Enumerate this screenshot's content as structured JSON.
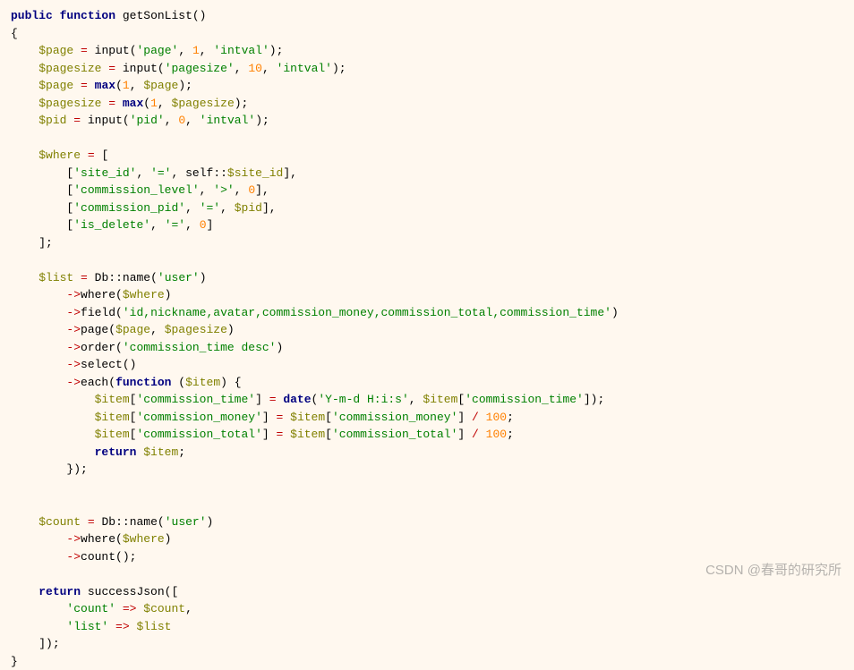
{
  "code": {
    "l1": {
      "kw1": "public",
      "kw2": "function",
      "name": "getSonList",
      "p": "()"
    },
    "l2": {
      "brace": "{"
    },
    "l3": {
      "var": "$page",
      "op": "=",
      "fn": "input",
      "p1": "(",
      "s1": "'page'",
      "c1": ",",
      "n1": "1",
      "c2": ",",
      "s2": "'intval'",
      "p2": ");"
    },
    "l4": {
      "var": "$pagesize",
      "op": "=",
      "fn": "input",
      "p1": "(",
      "s1": "'pagesize'",
      "c1": ",",
      "n1": "10",
      "c2": ",",
      "s2": "'intval'",
      "p2": ");"
    },
    "l5": {
      "var": "$page",
      "op": "=",
      "fn": "max",
      "p1": "(",
      "n1": "1",
      "c1": ",",
      "v2": "$page",
      "p2": ");"
    },
    "l6": {
      "var": "$pagesize",
      "op": "=",
      "fn": "max",
      "p1": "(",
      "n1": "1",
      "c1": ",",
      "v2": "$pagesize",
      "p2": ");"
    },
    "l7": {
      "var": "$pid",
      "op": "=",
      "fn": "input",
      "p1": "(",
      "s1": "'pid'",
      "c1": ",",
      "n1": "0",
      "c2": ",",
      "s2": "'intval'",
      "p2": ");"
    },
    "l9": {
      "var": "$where",
      "op": "=",
      "b": "["
    },
    "l10": {
      "b1": "[",
      "s1": "'site_id'",
      "c1": ",",
      "s2": "'='",
      "c2": ",",
      "scope": "self::",
      "prop": "$site_id",
      "b2": "],",
      "t": ""
    },
    "l11": {
      "b1": "[",
      "s1": "'commission_level'",
      "c1": ",",
      "s2": "'>'",
      "c2": ",",
      "n1": "0",
      "b2": "],",
      "t": ""
    },
    "l12": {
      "b1": "[",
      "s1": "'commission_pid'",
      "c1": ",",
      "s2": "'='",
      "c2": ",",
      "v1": "$pid",
      "b2": "],",
      "t": ""
    },
    "l13": {
      "b1": "[",
      "s1": "'is_delete'",
      "c1": ",",
      "s2": "'='",
      "c2": ",",
      "n1": "0",
      "b2": "]"
    },
    "l14": {
      "b": "];"
    },
    "l16": {
      "var": "$list",
      "op": "=",
      "cls": "Db",
      "sc": "::",
      "fn": "name",
      "p1": "(",
      "s1": "'user'",
      "p2": ")"
    },
    "l17": {
      "arw": "->",
      "fn": "where",
      "p1": "(",
      "v1": "$where",
      "p2": ")"
    },
    "l18": {
      "arw": "->",
      "fn": "field",
      "p1": "(",
      "s1": "'id,nickname,avatar,commission_money,commission_total,commission_time'",
      "p2": ")"
    },
    "l19": {
      "arw": "->",
      "fn": "page",
      "p1": "(",
      "v1": "$page",
      "c1": ",",
      "v2": "$pagesize",
      "p2": ")"
    },
    "l20": {
      "arw": "->",
      "fn": "order",
      "p1": "(",
      "s1": "'commission_time desc'",
      "p2": ")"
    },
    "l21": {
      "arw": "->",
      "fn": "select",
      "p": "()"
    },
    "l22": {
      "arw": "->",
      "fn": "each",
      "p1": "(",
      "kw": "function",
      "p2": "(",
      "v1": "$item",
      "p3": ")",
      "b": "{"
    },
    "l23": {
      "v1": "$item",
      "b1": "[",
      "s1": "'commission_time'",
      "b2": "]",
      "op": "=",
      "fn": "date",
      "p1": "(",
      "s2": "'Y-m-d H:i:s'",
      "c1": ",",
      "v2": "$item",
      "b3": "[",
      "s3": "'commission_time'",
      "b4": "]);",
      "t": ""
    },
    "l24": {
      "v1": "$item",
      "b1": "[",
      "s1": "'commission_money'",
      "b2": "]",
      "op": "=",
      "v2": "$item",
      "b3": "[",
      "s3": "'commission_money'",
      "b4": "]",
      "op2": "/",
      "n1": "100",
      "p": ";"
    },
    "l25": {
      "v1": "$item",
      "b1": "[",
      "s1": "'commission_total'",
      "b2": "]",
      "op": "=",
      "v2": "$item",
      "b3": "[",
      "s3": "'commission_total'",
      "b4": "]",
      "op2": "/",
      "n1": "100",
      "p": ";"
    },
    "l26": {
      "kw": "return",
      "v1": "$item",
      "p": ";"
    },
    "l27": {
      "b": "});"
    },
    "l30": {
      "var": "$count",
      "op": "=",
      "cls": "Db",
      "sc": "::",
      "fn": "name",
      "p1": "(",
      "s1": "'user'",
      "p2": ")"
    },
    "l31": {
      "arw": "->",
      "fn": "where",
      "p1": "(",
      "v1": "$where",
      "p2": ")"
    },
    "l32": {
      "arw": "->",
      "fn": "count",
      "p": "();"
    },
    "l34": {
      "kw": "return",
      "fn": "successJson",
      "p1": "(["
    },
    "l35": {
      "s1": "'count'",
      "arw": "=>",
      "v1": "$count",
      "c": ","
    },
    "l36": {
      "s1": "'list'",
      "arw": "=>",
      "v1": "$list"
    },
    "l37": {
      "b": "]);"
    },
    "l38": {
      "brace": "}"
    }
  },
  "watermark": "CSDN @春哥的研究所"
}
